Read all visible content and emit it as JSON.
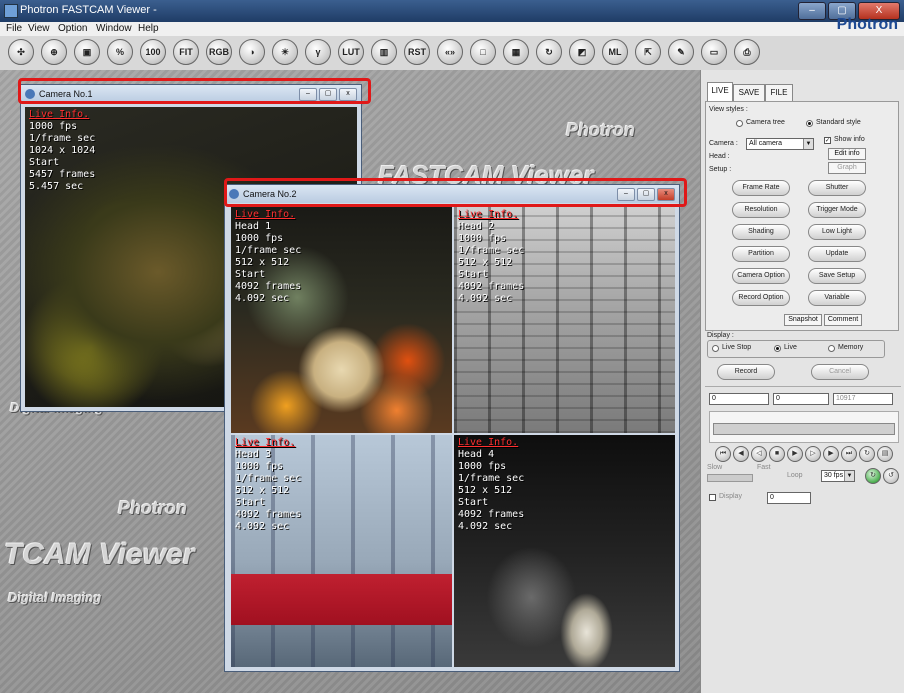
{
  "window": {
    "title": "Photron FASTCAM Viewer -",
    "brand": "Photron",
    "buttons": [
      "–",
      "▢",
      "X"
    ]
  },
  "menu": [
    "File",
    "View",
    "Option",
    "Window",
    "Help"
  ],
  "toolbar": [
    {
      "icon": "move-icon",
      "label": "✣"
    },
    {
      "icon": "zoom-in-icon",
      "label": "⊕"
    },
    {
      "icon": "window-icon",
      "label": "▣"
    },
    {
      "icon": "percent-icon",
      "label": "%"
    },
    {
      "icon": "zoom-100-icon",
      "label": "100"
    },
    {
      "icon": "fit-icon",
      "label": "FIT"
    },
    {
      "icon": "rgb-icon",
      "label": "RGB"
    },
    {
      "icon": "contrast-icon",
      "label": "◑"
    },
    {
      "icon": "brightness-icon",
      "label": "☀"
    },
    {
      "icon": "gamma-icon",
      "label": "γ"
    },
    {
      "icon": "lut-reset-icon",
      "label": "LUT"
    },
    {
      "icon": "color-bars-icon",
      "label": "▥"
    },
    {
      "icon": "color-reset-icon",
      "label": "RST"
    },
    {
      "icon": "unsharp-icon",
      "label": "«»"
    },
    {
      "icon": "frame-icon",
      "label": "□"
    },
    {
      "icon": "grid-icon",
      "label": "▦"
    },
    {
      "icon": "rotate-icon",
      "label": "↻"
    },
    {
      "icon": "image-icon",
      "label": "◩"
    },
    {
      "icon": "multi-lock-icon",
      "label": "ML"
    },
    {
      "icon": "trigger-icon",
      "label": "⇱"
    },
    {
      "icon": "pen-icon",
      "label": "✎"
    },
    {
      "icon": "keyboard-icon",
      "label": "▭"
    },
    {
      "icon": "printer-icon",
      "label": "⎙"
    }
  ],
  "watermark": {
    "brand": "Photron",
    "product": "FASTCAM Viewer",
    "product_fragment": "TCAM Viewer",
    "tagline": "Digital Imaging"
  },
  "camera1": {
    "title": "Camera No.1",
    "info": [
      "Live Info.",
      "1000 fps",
      "1/frame sec",
      "1024 x 1024",
      "Start",
      "5457 frames",
      "5.457 sec"
    ]
  },
  "camera2": {
    "title": "Camera No.2",
    "heads": [
      {
        "info": [
          "Live Info.",
          "Head 1",
          "1000 fps",
          "1/frame sec",
          "512 x 512",
          "Start",
          "4092 frames",
          "4.092 sec"
        ]
      },
      {
        "info": [
          "Live Info.",
          "Head 2",
          "1000 fps",
          "1/frame sec",
          "512 x 512",
          "Start",
          "4092 frames",
          "4.092 sec"
        ]
      },
      {
        "info": [
          "Live Info.",
          "Head 3",
          "1000 fps",
          "1/frame sec",
          "512 x 512",
          "Start",
          "4092 frames",
          "4.092 sec"
        ]
      },
      {
        "info": [
          "Live Info.",
          "Head 4",
          "1000 fps",
          "1/frame sec",
          "512 x 512",
          "Start",
          "4092 frames",
          "4.092 sec"
        ]
      }
    ]
  },
  "panel": {
    "tabs": [
      "LIVE",
      "SAVE",
      "FILE"
    ],
    "view_styles_label": "View styles :",
    "camera_tree": "Camera tree",
    "standard_style": "Standard style",
    "camera_label": "Camera :",
    "camera_value": "All camera",
    "show_info": "Show info",
    "edit_info": "Edit info",
    "head_label": "Head :",
    "graph": "Graph",
    "setup_label": "Setup :",
    "setup_buttons": [
      "Frame Rate",
      "Shutter",
      "Resolution",
      "Trigger Mode",
      "Shading",
      "Low Light",
      "Partition",
      "Update",
      "Camera Option",
      "Save Setup",
      "Record Option",
      "Variable"
    ],
    "snapshot": "Snapshot",
    "comment": "Comment",
    "display_label": "Display :",
    "live_stop": "Live Stop",
    "live": "Live",
    "memory": "Memory",
    "record": "Record",
    "cancel": "Cancel",
    "slider_start": "0",
    "slider_mid": "0",
    "slider_end": "10917",
    "fps_value": "30 fps",
    "display_chk": "Display",
    "display_value": "0",
    "playback_labels": [
      "Slow",
      "Fast",
      "Loop"
    ]
  }
}
